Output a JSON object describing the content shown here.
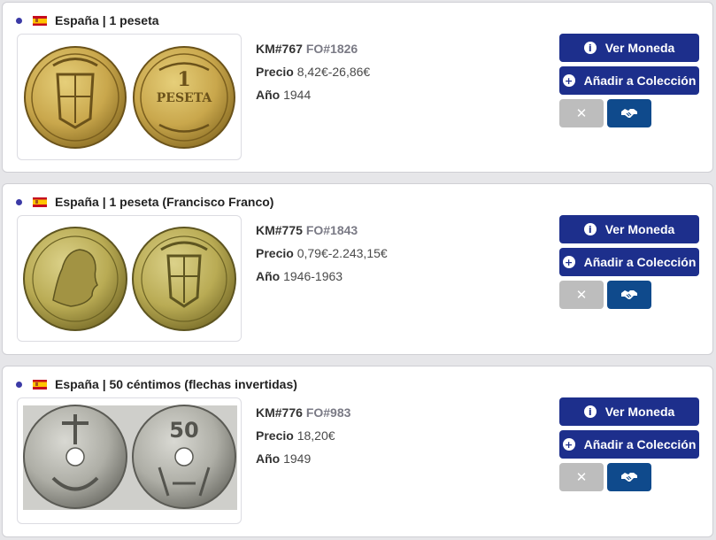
{
  "colors": {
    "accent": "#1d2f8c",
    "trade_button": "#0f4a8c",
    "remove_button": "#bdbdbd",
    "bullet": "#3b3aa6"
  },
  "labels": {
    "precio": "Precio",
    "anio": "Año",
    "ver_moneda": "Ver Moneda",
    "anadir_coleccion": "Añadir a Colección",
    "remove_symbol": "✕"
  },
  "coins": [
    {
      "flag_icon": "spain-flag-icon",
      "title": "España | 1 peseta",
      "km": "KM#767",
      "fo": "FO#1826",
      "precio": "8,42€-26,86€",
      "anio": "1944",
      "image": "brass-coins-eagle"
    },
    {
      "flag_icon": "spain-flag-icon",
      "title": "España | 1 peseta (Francisco Franco)",
      "km": "KM#775",
      "fo": "FO#1843",
      "precio": "0,79€-2.243,15€",
      "anio": "1946-1963",
      "image": "brass-coins-portrait"
    },
    {
      "flag_icon": "spain-flag-icon",
      "title": "España | 50 céntimos (flechas invertidas)",
      "km": "KM#776",
      "fo": "FO#983",
      "precio": "18,20€",
      "anio": "1949",
      "image": "holed-coins-anchor"
    }
  ]
}
